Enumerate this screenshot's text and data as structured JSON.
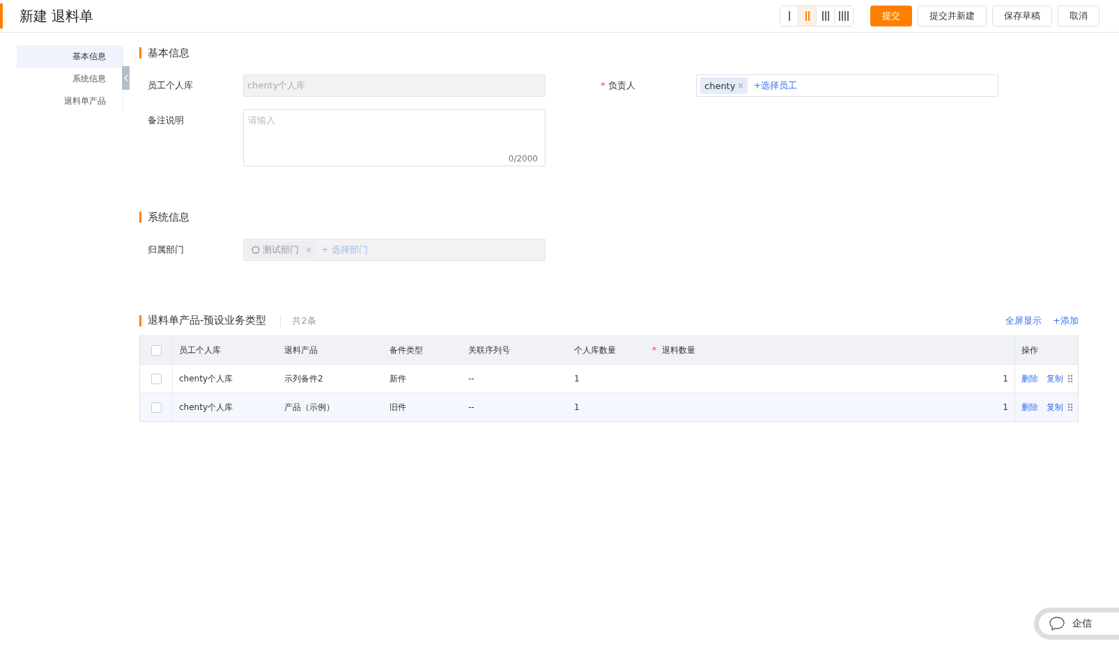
{
  "header": {
    "title": "新建 退料单",
    "layout_options": [
      {
        "selected": false
      },
      {
        "selected": true
      },
      {
        "selected": false
      },
      {
        "selected": false
      }
    ],
    "buttons": [
      {
        "label": "提交",
        "kind": "primary"
      },
      {
        "label": "提交并新建",
        "kind": "default"
      },
      {
        "label": "保存草稿",
        "kind": "default"
      },
      {
        "label": "取消",
        "kind": "default"
      }
    ]
  },
  "sidebar": {
    "items": [
      {
        "label": "基本信息",
        "selected": true
      },
      {
        "label": "系统信息",
        "selected": false
      },
      {
        "label": "退料单产品",
        "selected": false
      }
    ]
  },
  "basic_info": {
    "title": "基本信息",
    "personal_store": {
      "label": "员工个人库",
      "value": "chenty个人库",
      "disabled": true
    },
    "owner": {
      "label": "负责人",
      "required_mark": "*",
      "tags": [
        "chenty"
      ],
      "action": "+选择员工"
    },
    "remark": {
      "label": "备注说明",
      "placeholder": "请输入",
      "counter": "0/2000"
    }
  },
  "system_info": {
    "title": "系统信息",
    "department": {
      "label": "归属部门",
      "disabled": true,
      "tags": [
        "测试部门"
      ],
      "action": "+ 选择部门"
    }
  },
  "products": {
    "title": "退料单产品-预设业务类型",
    "count": "共2条",
    "actions": [
      "全屏显示",
      "+添加"
    ],
    "select_all_checked": false,
    "columns": [
      {
        "label": "员工个人库"
      },
      {
        "label": "退料产品"
      },
      {
        "label": "备件类型"
      },
      {
        "label": "关联序列号"
      },
      {
        "label": "个人库数量"
      },
      {
        "label": "退料数量",
        "required_mark": "*"
      },
      {
        "label": "操作"
      }
    ],
    "rows": [
      {
        "checked": false,
        "cells": [
          "chenty个人库",
          "示列备件2",
          "新件",
          "--",
          "1",
          "1"
        ],
        "actions": [
          "删除",
          "复制"
        ]
      },
      {
        "checked": false,
        "cells": [
          "chenty个人库",
          "产品（示例）",
          "旧件",
          "--",
          "1",
          "1"
        ],
        "actions": [
          "删除",
          "复制"
        ]
      }
    ]
  },
  "chat_widget": {
    "label": "企信"
  }
}
